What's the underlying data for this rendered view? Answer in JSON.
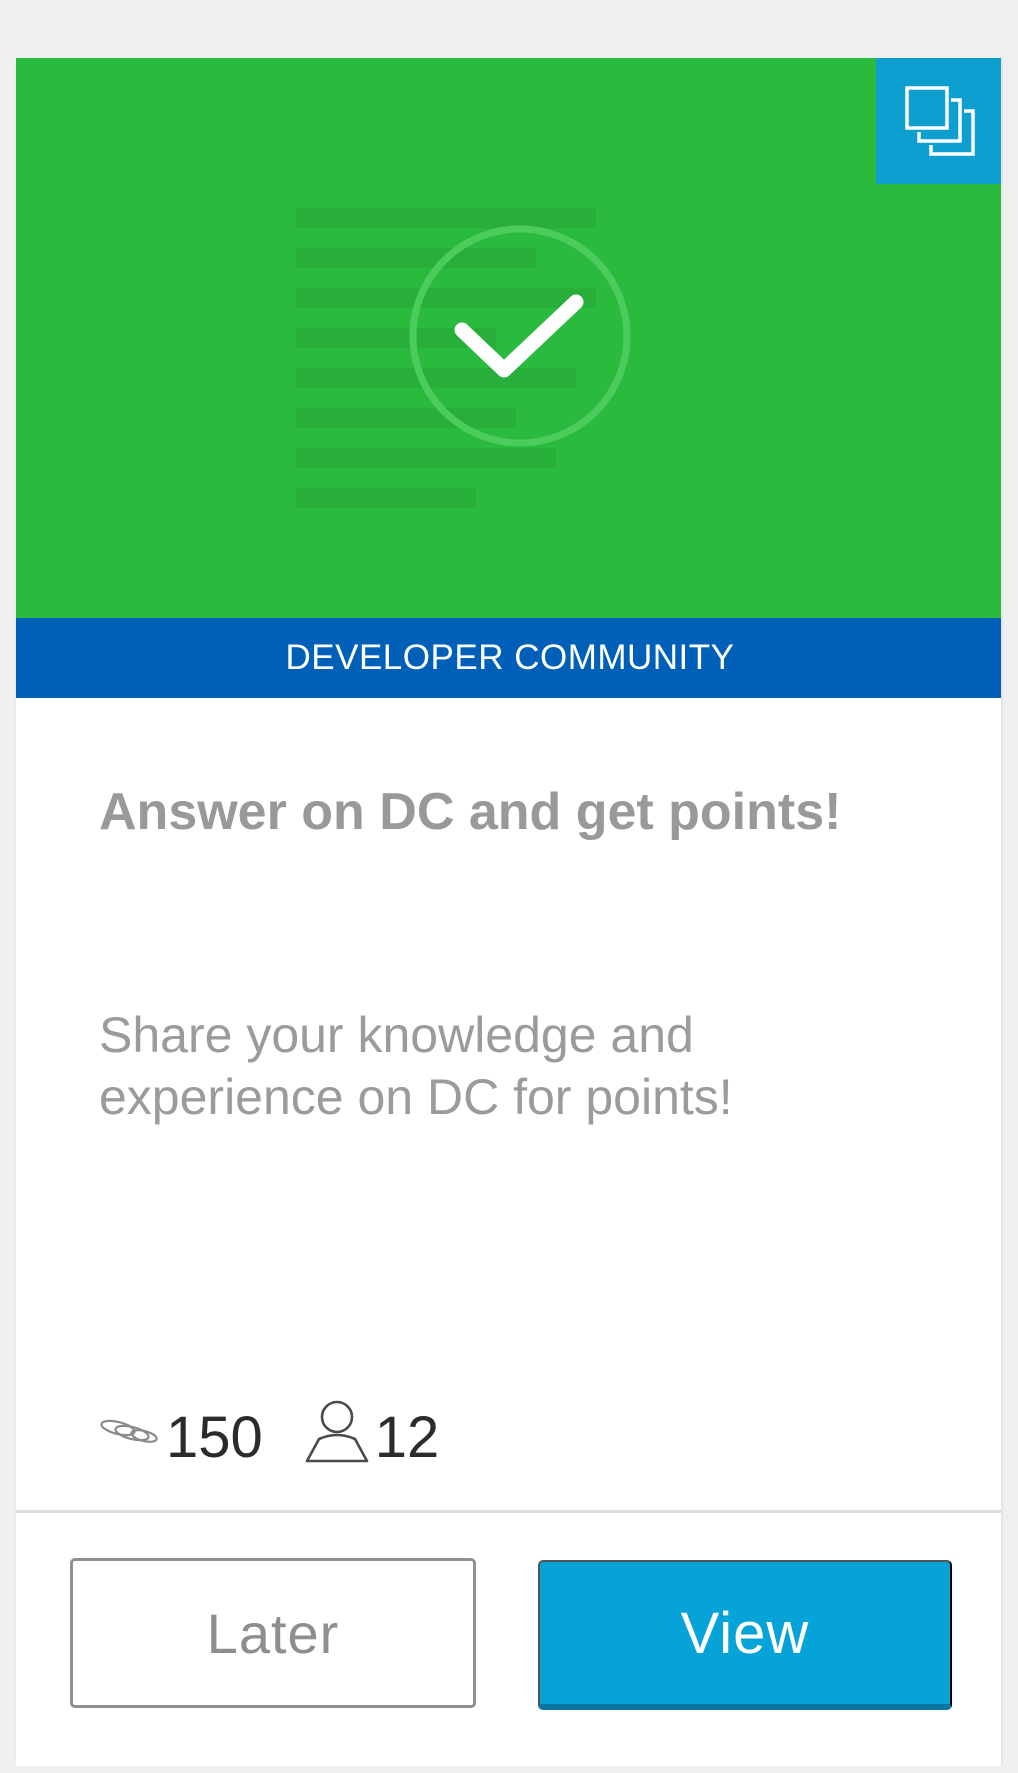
{
  "card": {
    "category": "DEVELOPER COMMUNITY",
    "title": "Answer on DC and get points!",
    "description": "Share your knowledge and experience on DC for points!",
    "stats": {
      "points": "150",
      "members": "12"
    },
    "icons": {
      "hero": "checkmark-circle-icon",
      "collection": "stacked-cards-icon",
      "points": "coins-icon",
      "members": "user-icon"
    },
    "actions": {
      "later_label": "Later",
      "view_label": "View"
    },
    "colors": {
      "hero_background": "#2aba3e",
      "banner_background": "#0060b8",
      "collection_badge": "#0d9fcf",
      "primary_button": "#05a3d8"
    }
  }
}
